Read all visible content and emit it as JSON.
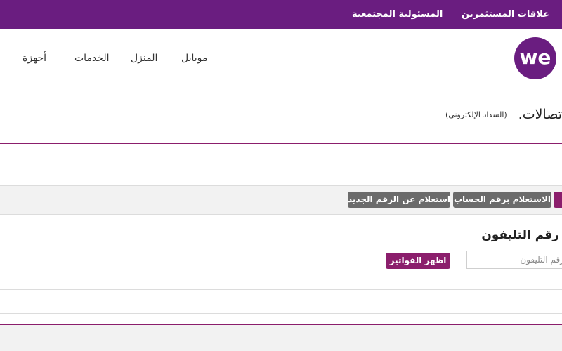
{
  "topbar": {
    "investor_relations": "علاقات المستثمرين",
    "social_responsibility": "المسئولية المجتمعية"
  },
  "logo": {
    "text": "we"
  },
  "nav": {
    "mobile": "موبايل",
    "home": "المنزل",
    "services": "الخدمات",
    "devices": "أجهزة"
  },
  "header": {
    "title": "تصالات.",
    "subtitle": "(السداد الإلكتروني)"
  },
  "tabs": [
    {
      "label": ""
    },
    {
      "label": "الاستعلام برقم الحساب"
    },
    {
      "label": "استعلام عن الرقم الجديد"
    }
  ],
  "form": {
    "section_title": "رقم التليفون",
    "phone_placeholder": "رقم التليفون",
    "show_bills_label": "اظهر الفواتير"
  },
  "colors": {
    "brand_purple": "#6a1d80",
    "accent_magenta": "#8b1e6c",
    "tab_gray": "#6b6b6b"
  }
}
